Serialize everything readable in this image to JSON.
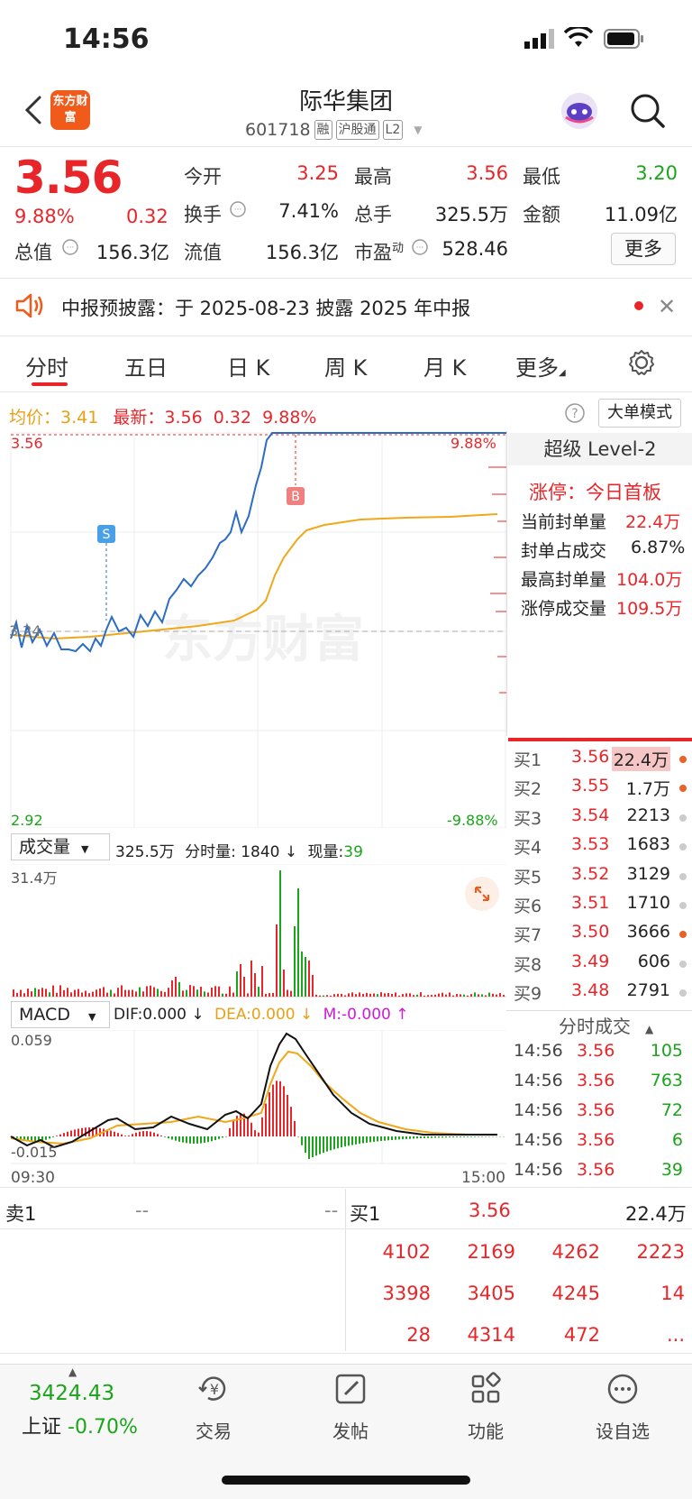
{
  "status_bar": {
    "time": "14:56"
  },
  "header": {
    "app_logo": "东方财富",
    "title": "际华集团",
    "code": "601718",
    "tags": [
      "融",
      "沪股通",
      "L2"
    ]
  },
  "quote": {
    "price": "3.56",
    "pct_change": "9.88%",
    "amount_change": "0.32",
    "fields": [
      {
        "label": "今开",
        "value": "3.25",
        "color": "#e8262a"
      },
      {
        "label": "最高",
        "value": "3.56",
        "color": "#e8262a"
      },
      {
        "label": "最低",
        "value": "3.20",
        "color": "#1aa51a"
      },
      {
        "label": "换手",
        "value": "7.41%",
        "color": "#222222"
      },
      {
        "label": "总手",
        "value": "325.5万",
        "color": "#222222"
      },
      {
        "label": "金额",
        "value": "11.09亿",
        "color": "#222222"
      },
      {
        "label": "总值",
        "value": "156.3亿",
        "color": "#222222"
      },
      {
        "label": "流值",
        "value": "156.3亿",
        "color": "#222222"
      },
      {
        "label": "市盈",
        "value": "528.46",
        "color": "#222222"
      }
    ],
    "pe_sup": "动",
    "more_label": "更多"
  },
  "notice": {
    "text": "中报预披露：于 2025-08-23 披露 2025 年中报"
  },
  "tabs": [
    "分时",
    "五日",
    "日 K",
    "周 K",
    "月 K",
    "更多"
  ],
  "legend": {
    "avg_label": "均价：",
    "avg_value": "3.41",
    "latest_label": "最新：",
    "latest_value": "3.56",
    "latest_chg": "0.32",
    "latest_pct": "9.88%",
    "big_order_mode": "大单模式"
  },
  "intraday": {
    "y_top": "3.56",
    "y_bottom": "2.92",
    "pct_top": "9.88%",
    "pct_bottom": "-9.88%",
    "prev_close_label": "3.24",
    "watermark": "东方财富",
    "markers": [
      "S",
      "B"
    ]
  },
  "volume_bar": {
    "selector": "成交量",
    "total": "325.5万",
    "minute_label": "分时量: 1840 ↓",
    "current_label": "现量:",
    "current_value": "39",
    "max_label": "31.4万"
  },
  "macd_bar": {
    "selector": "MACD",
    "dif": "DIF:0.000 ↓",
    "dea": "DEA:0.000 ↓",
    "m": "M:-0.000 ↑",
    "top": "0.059",
    "bottom": "-0.015",
    "time_start": "09:30",
    "time_end": "15:00"
  },
  "level2": {
    "title": "超级 Level-2",
    "limit_label": "涨停：",
    "limit_value": "今日首板",
    "stats": [
      {
        "label": "当前封单量",
        "value": "22.4万"
      },
      {
        "label": "封单占成交",
        "value": "6.87%"
      },
      {
        "label": "最高封单量",
        "value": "104.0万"
      },
      {
        "label": "涨停成交量",
        "value": "109.5万"
      }
    ]
  },
  "order_book": [
    {
      "label": "买1",
      "price": "3.56",
      "vol": "22.4万"
    },
    {
      "label": "买2",
      "price": "3.55",
      "vol": "1.7万"
    },
    {
      "label": "买3",
      "price": "3.54",
      "vol": "2213"
    },
    {
      "label": "买4",
      "price": "3.53",
      "vol": "1683"
    },
    {
      "label": "买5",
      "price": "3.52",
      "vol": "3129"
    },
    {
      "label": "买6",
      "price": "3.51",
      "vol": "1710"
    },
    {
      "label": "买7",
      "price": "3.50",
      "vol": "3666"
    },
    {
      "label": "买8",
      "price": "3.49",
      "vol": "606"
    },
    {
      "label": "买9",
      "price": "3.48",
      "vol": "2791"
    }
  ],
  "ticks": {
    "title": "分时成交",
    "rows": [
      {
        "time": "14:56",
        "price": "3.56",
        "vol": "105"
      },
      {
        "time": "14:56",
        "price": "3.56",
        "vol": "763"
      },
      {
        "time": "14:56",
        "price": "3.56",
        "vol": "72"
      },
      {
        "time": "14:56",
        "price": "3.56",
        "vol": "6"
      },
      {
        "time": "14:56",
        "price": "3.56",
        "vol": "39"
      }
    ]
  },
  "queue": {
    "sell_label": "卖1",
    "sell_price": "--",
    "sell_vol": "--",
    "buy_label": "买1",
    "buy_price": "3.56",
    "buy_vol": "22.4万",
    "rows": [
      [
        "4102",
        "2169",
        "4262",
        "2223"
      ],
      [
        "3398",
        "3405",
        "4245",
        "14"
      ],
      [
        "28",
        "4314",
        "472",
        "..."
      ]
    ]
  },
  "bottom_nav": {
    "index_value": "3424.43",
    "index_name": "上证",
    "index_pct": "-0.70%",
    "items": [
      "交易",
      "发帖",
      "功能",
      "设自选"
    ]
  },
  "colors": {
    "up": "#e8262a",
    "down": "#1aa51a",
    "price_line": "#2b6cc4",
    "avg_line": "#f0a81a",
    "brand": "#f05a1a"
  }
}
